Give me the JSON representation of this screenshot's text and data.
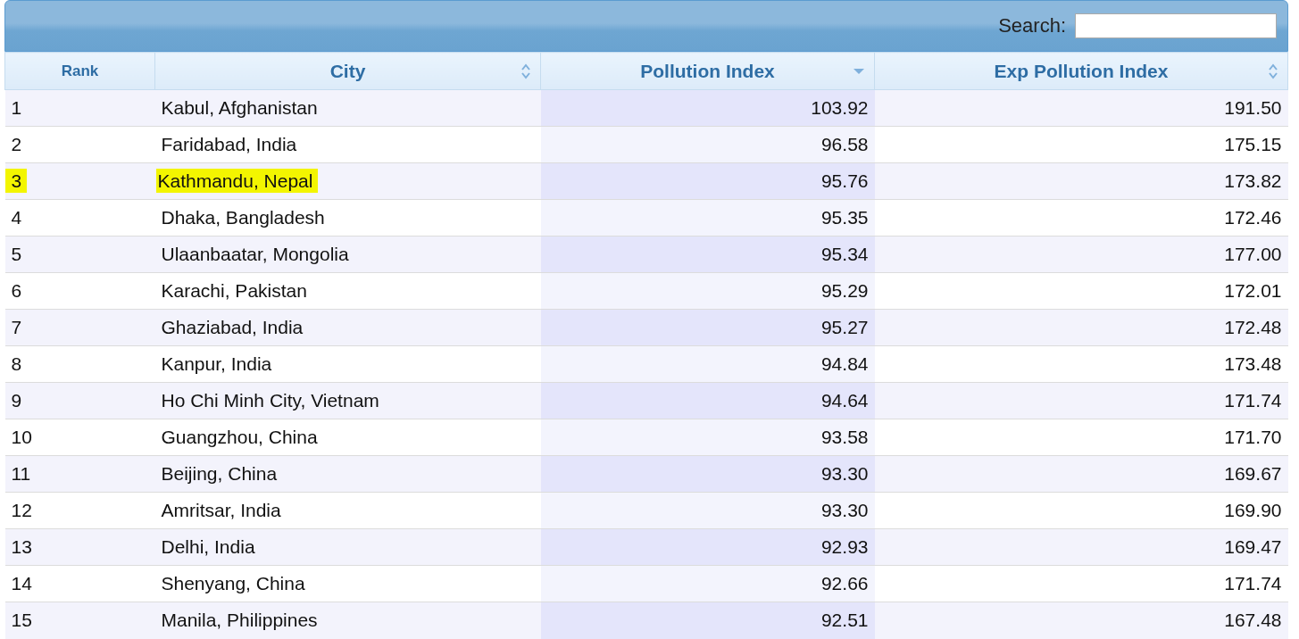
{
  "search": {
    "label": "Search:"
  },
  "table": {
    "columns": [
      {
        "label": "Rank",
        "sortable": false,
        "sorted_descending": false
      },
      {
        "label": "City",
        "sortable": true,
        "sorted_descending": false
      },
      {
        "label": "Pollution Index",
        "sortable": true,
        "sorted_descending": true
      },
      {
        "label": "Exp Pollution Index",
        "sortable": true,
        "sorted_descending": false
      }
    ],
    "rows": [
      {
        "rank": "1",
        "city": "Kabul, Afghanistan",
        "pollution_index": "103.92",
        "exp_pollution_index": "191.50",
        "highlighted": false
      },
      {
        "rank": "2",
        "city": "Faridabad, India",
        "pollution_index": "96.58",
        "exp_pollution_index": "175.15",
        "highlighted": false
      },
      {
        "rank": "3",
        "city": "Kathmandu, Nepal",
        "pollution_index": "95.76",
        "exp_pollution_index": "173.82",
        "highlighted": true
      },
      {
        "rank": "4",
        "city": "Dhaka, Bangladesh",
        "pollution_index": "95.35",
        "exp_pollution_index": "172.46",
        "highlighted": false
      },
      {
        "rank": "5",
        "city": "Ulaanbaatar, Mongolia",
        "pollution_index": "95.34",
        "exp_pollution_index": "177.00",
        "highlighted": false
      },
      {
        "rank": "6",
        "city": "Karachi, Pakistan",
        "pollution_index": "95.29",
        "exp_pollution_index": "172.01",
        "highlighted": false
      },
      {
        "rank": "7",
        "city": "Ghaziabad, India",
        "pollution_index": "95.27",
        "exp_pollution_index": "172.48",
        "highlighted": false
      },
      {
        "rank": "8",
        "city": "Kanpur, India",
        "pollution_index": "94.84",
        "exp_pollution_index": "173.48",
        "highlighted": false
      },
      {
        "rank": "9",
        "city": "Ho Chi Minh City, Vietnam",
        "pollution_index": "94.64",
        "exp_pollution_index": "171.74",
        "highlighted": false
      },
      {
        "rank": "10",
        "city": "Guangzhou, China",
        "pollution_index": "93.58",
        "exp_pollution_index": "171.70",
        "highlighted": false
      },
      {
        "rank": "11",
        "city": "Beijing, China",
        "pollution_index": "93.30",
        "exp_pollution_index": "169.67",
        "highlighted": false
      },
      {
        "rank": "12",
        "city": "Amritsar, India",
        "pollution_index": "93.30",
        "exp_pollution_index": "169.90",
        "highlighted": false
      },
      {
        "rank": "13",
        "city": "Delhi, India",
        "pollution_index": "92.93",
        "exp_pollution_index": "169.47",
        "highlighted": false
      },
      {
        "rank": "14",
        "city": "Shenyang, China",
        "pollution_index": "92.66",
        "exp_pollution_index": "171.74",
        "highlighted": false
      },
      {
        "rank": "15",
        "city": "Manila, Philippines",
        "pollution_index": "92.51",
        "exp_pollution_index": "167.48",
        "highlighted": false
      }
    ]
  }
}
